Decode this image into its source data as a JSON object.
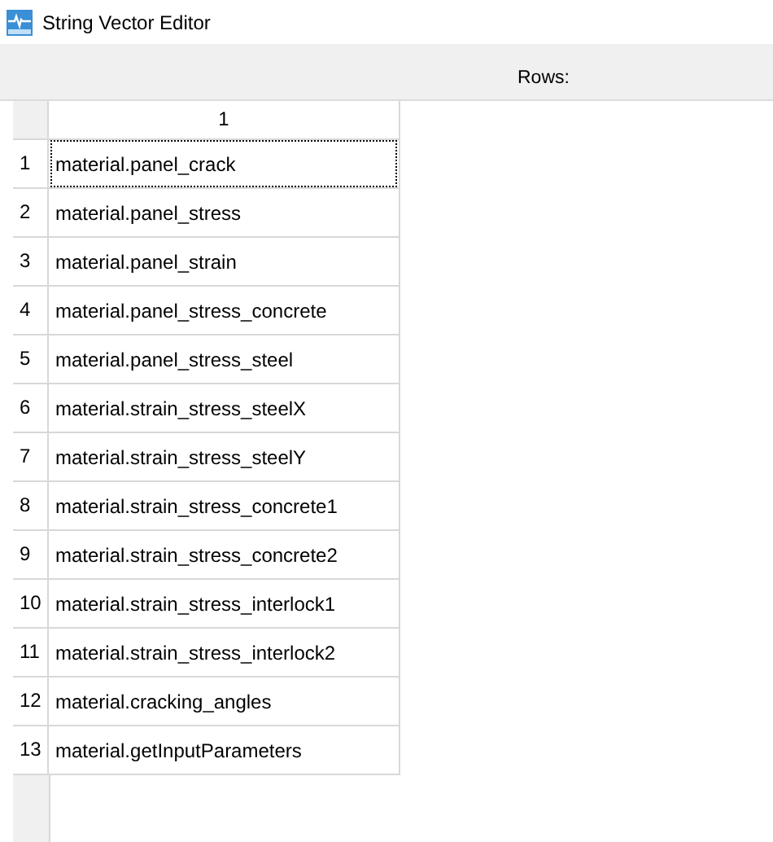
{
  "window": {
    "title": "String Vector Editor"
  },
  "toolbar": {
    "rows_label": "Rows:"
  },
  "table": {
    "columns": [
      "1"
    ],
    "rows": [
      {
        "header": "1",
        "value": "material.panel_crack",
        "focused": true
      },
      {
        "header": "2",
        "value": "material.panel_stress",
        "focused": false
      },
      {
        "header": "3",
        "value": "material.panel_strain",
        "focused": false
      },
      {
        "header": "4",
        "value": "material.panel_stress_concrete",
        "focused": false
      },
      {
        "header": "5",
        "value": "material.panel_stress_steel",
        "focused": false
      },
      {
        "header": "6",
        "value": "material.strain_stress_steelX",
        "focused": false
      },
      {
        "header": "7",
        "value": "material.strain_stress_steelY",
        "focused": false
      },
      {
        "header": "8",
        "value": "material.strain_stress_concrete1",
        "focused": false
      },
      {
        "header": "9",
        "value": "material.strain_stress_concrete2",
        "focused": false
      },
      {
        "header": "10",
        "value": "material.strain_stress_interlock1",
        "focused": false
      },
      {
        "header": "11",
        "value": "material.strain_stress_interlock2",
        "focused": false
      },
      {
        "header": "12",
        "value": "material.cracking_angles",
        "focused": false
      },
      {
        "header": "13",
        "value": "material.getInputParameters",
        "focused": false
      }
    ]
  }
}
